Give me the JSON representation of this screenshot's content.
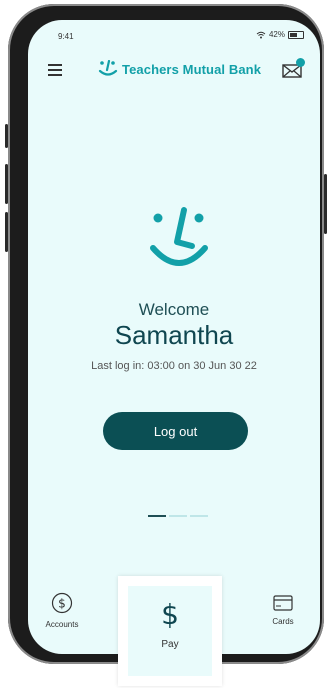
{
  "status_bar": {
    "time": "9:41",
    "battery": "42%"
  },
  "header": {
    "brand": "Teachers Mutual Bank",
    "icons": {
      "menu": "hamburger-icon",
      "mail": "mail-icon"
    }
  },
  "welcome": {
    "greeting": "Welcome",
    "name": "Samantha",
    "last_login": "Last log in: 03:00 on 30 Jun 30 22"
  },
  "logout_label": "Log out",
  "pager": {
    "page": 1,
    "count": 3
  },
  "nav": {
    "accounts": "Accounts",
    "pay": "Pay",
    "cards": "Cards"
  },
  "colors": {
    "accent": "#12a0a8",
    "dark": "#0b4f54",
    "background": "#e9fbfb"
  }
}
